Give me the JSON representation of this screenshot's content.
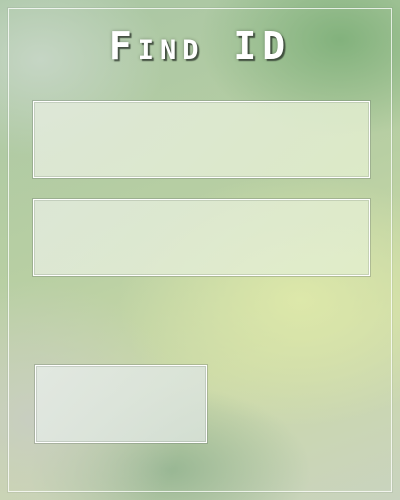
{
  "window": {
    "title": "Find ID"
  },
  "form": {
    "field_1": {
      "value": "",
      "placeholder": ""
    },
    "field_2": {
      "value": "",
      "placeholder": ""
    },
    "submit_label": ""
  },
  "colors": {
    "title_text": "#ffffff",
    "background_green": "#a9c6a4",
    "background_yellow": "#cbd9a8"
  }
}
